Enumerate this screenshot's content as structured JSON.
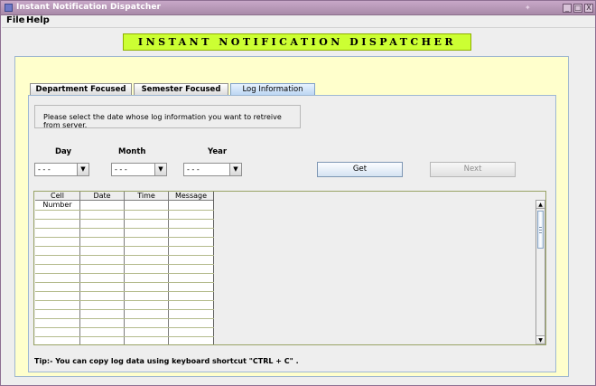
{
  "window": {
    "title": "Instant Notification Dispatcher",
    "controls": {
      "minimize": "_",
      "maximize": "□",
      "close": "X"
    }
  },
  "menu": {
    "file": "File",
    "help": "Help"
  },
  "banner": {
    "text": "INSTANT NOTIFICATION DISPATCHER",
    "color": "#ccff33"
  },
  "tabs": [
    {
      "label": "Department Focused",
      "active": false
    },
    {
      "label": "Semester Focused",
      "active": false
    },
    {
      "label": "Log Information",
      "active": true
    }
  ],
  "log": {
    "hint": "Please select the date whose log information you want to retreive from server.",
    "labels": {
      "day": "Day",
      "month": "Month",
      "year": "Year"
    },
    "selects": {
      "day": "- - -",
      "month": "- - -",
      "year": "- - -"
    },
    "buttons": {
      "get": "Get",
      "next": "Next"
    },
    "table": {
      "headers": [
        "Cell Number",
        "Date",
        "Time",
        "Message"
      ],
      "rows": []
    },
    "tip": "Tip:- You can copy log data using keyboard shortcut  \"CTRL + C\" ."
  },
  "colors": {
    "panel_bg": "#ffffcc",
    "active_tab": "#bcd6f3",
    "title_bar": "#b393b3"
  }
}
